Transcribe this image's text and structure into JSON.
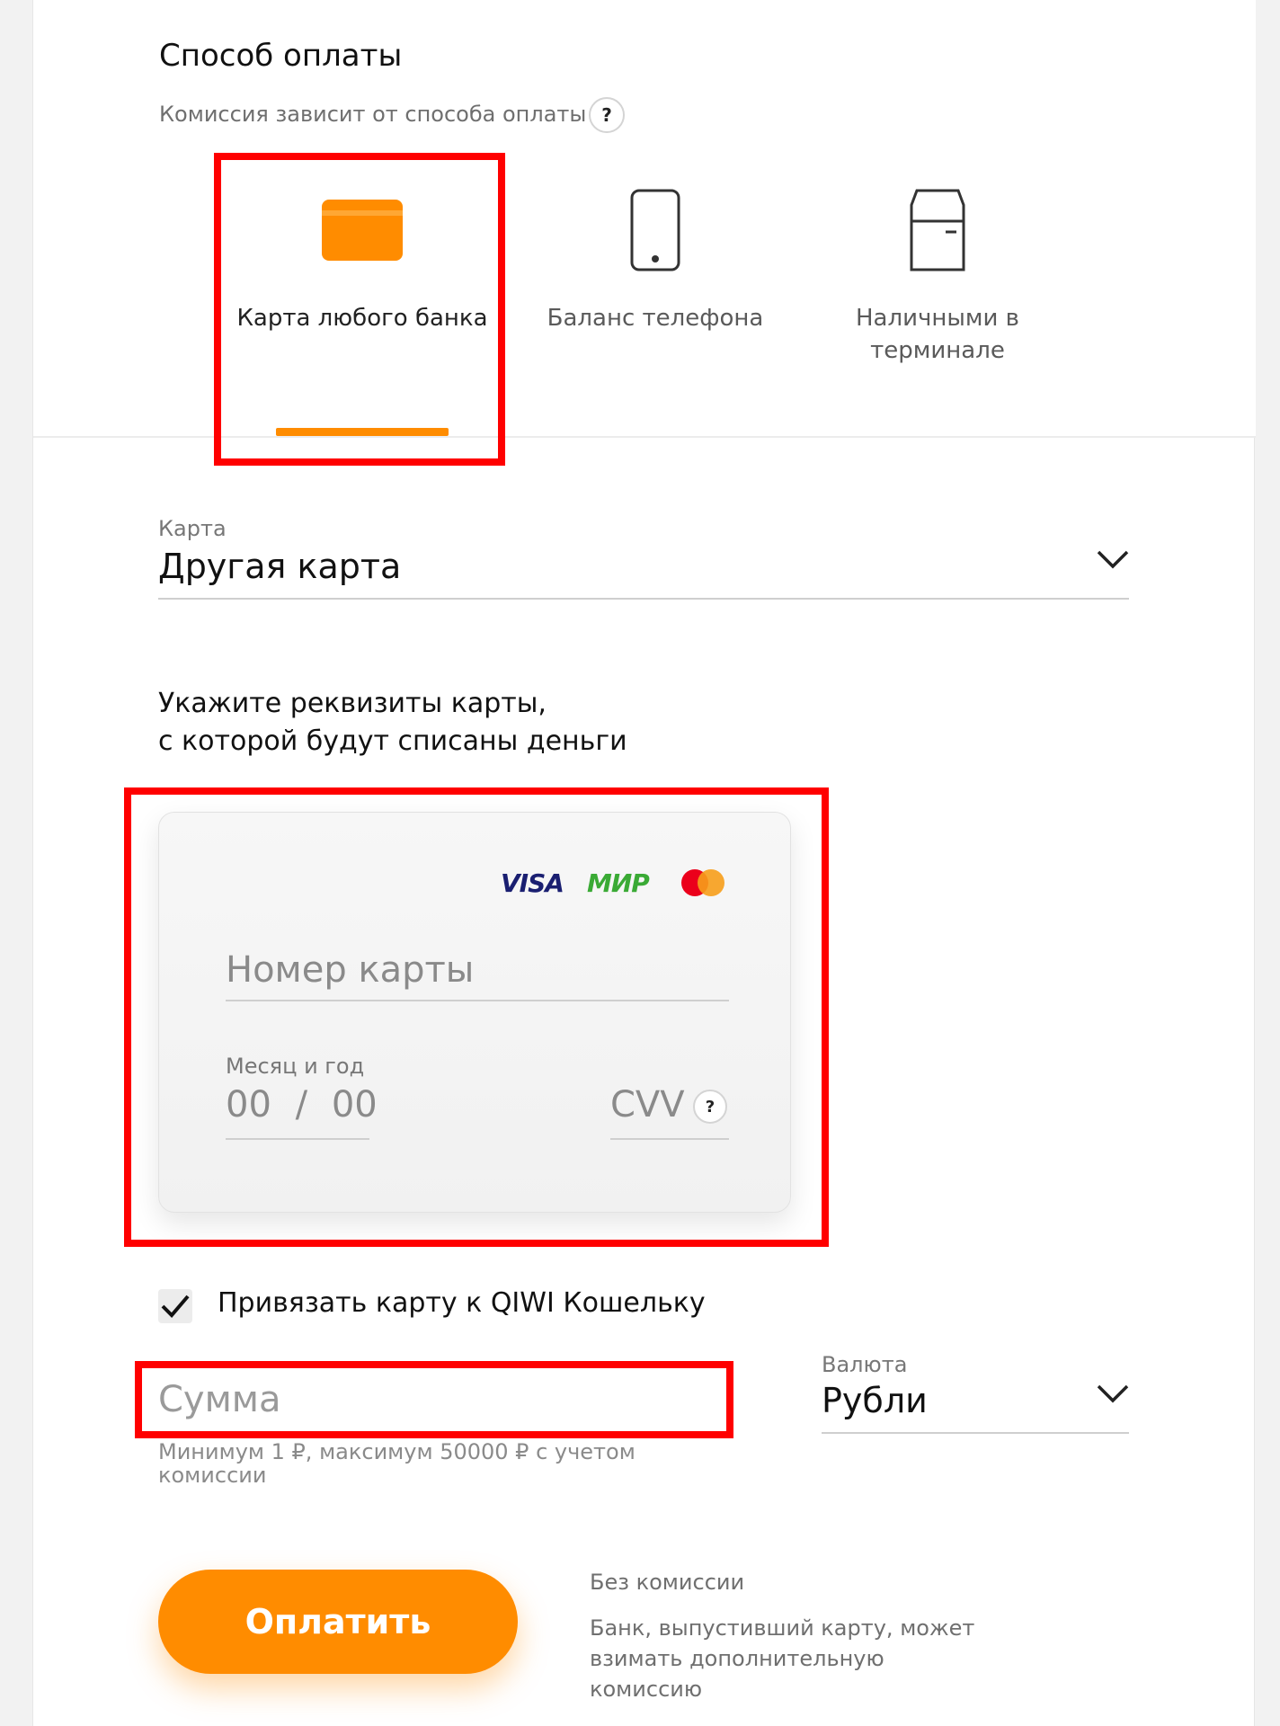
{
  "header": {
    "title": "Способ оплаты",
    "subtitle": "Комиссия зависит от способа оплаты",
    "help_glyph": "?"
  },
  "methods": [
    {
      "label": "Карта любого банка",
      "icon": "card-icon",
      "selected": true
    },
    {
      "label": "Баланс телефона",
      "icon": "phone-icon",
      "selected": false
    },
    {
      "label": "Наличными в терминале",
      "icon": "terminal-icon",
      "selected": false
    }
  ],
  "card_select": {
    "label": "Карта",
    "value": "Другая карта"
  },
  "instruction": {
    "line1": "Укажите реквизиты карты,",
    "line2": "с которой будут списаны деньги"
  },
  "card_form": {
    "brands": [
      "VISA",
      "МИР",
      "Mastercard"
    ],
    "number_placeholder": "Номер карты",
    "expiry_label": "Месяц и год",
    "expiry_month": "00",
    "expiry_sep": "/",
    "expiry_year": "00",
    "cvv_placeholder": "CVV",
    "cvv_help": "?"
  },
  "link_card": {
    "checked": true,
    "label": "Привязать карту к QIWI Кошельку"
  },
  "amount": {
    "placeholder": "Сумма",
    "hint": "Минимум 1 ₽, максимум 50000 ₽ с учетом комиссии"
  },
  "currency": {
    "label": "Валюта",
    "value": "Рубли"
  },
  "pay": {
    "button_label": "Оплатить",
    "fee_title": "Без комиссии",
    "fee_note": "Банк, выпустивший карту, может взимать дополнительную комиссию"
  },
  "colors": {
    "accent": "#ff8c00",
    "highlight": "#ff0000",
    "visa": "#1a1f71",
    "mir": "#3aaa35"
  }
}
